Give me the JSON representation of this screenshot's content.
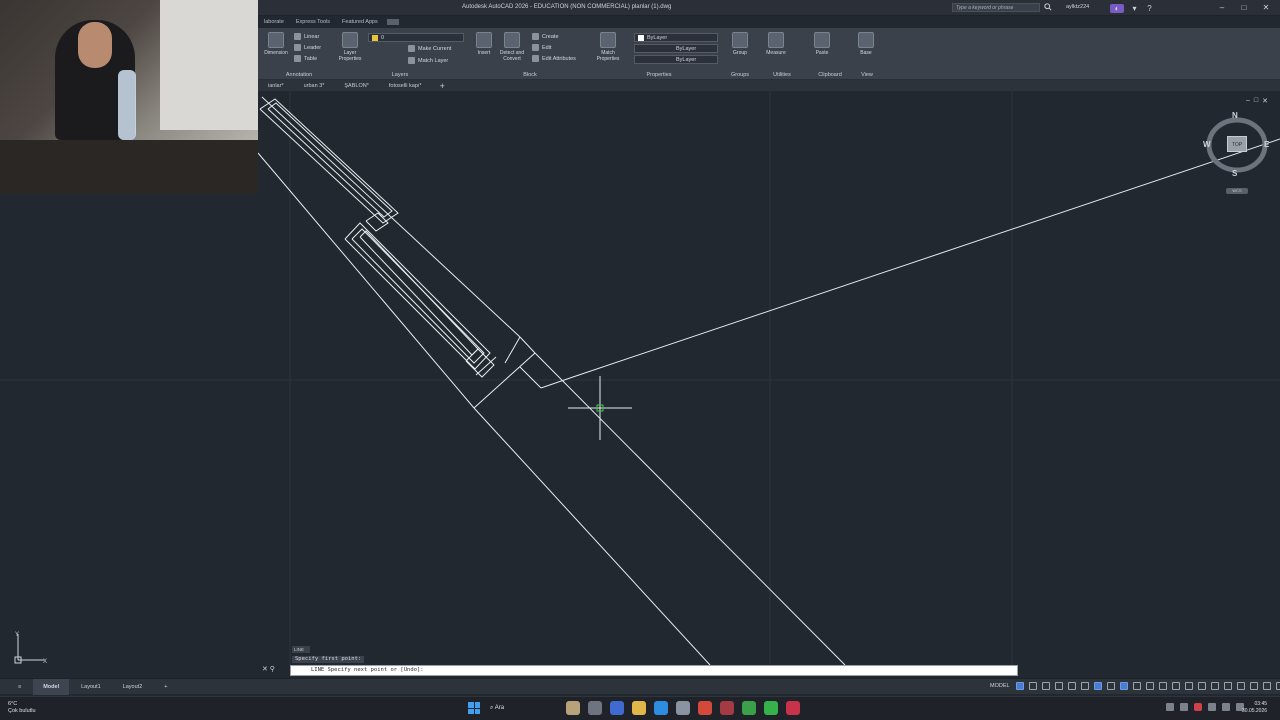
{
  "titlebar": {
    "app_title": "Autodesk AutoCAD 2026 - EDUCATION (NON COMMERCIAL)   planlar (1).dwg",
    "search_placeholder": "Type a keyword or phrase",
    "user_name": "aylktz224"
  },
  "ribbon_tabs": [
    "laborate",
    "Express Tools",
    "Featured Apps"
  ],
  "ribbon": {
    "annotation": {
      "dimension": "Dimension",
      "linear": "Linear",
      "leader": "Leader",
      "table": "Table",
      "label": "Annotation"
    },
    "layers": {
      "layer_properties": "Layer Properties",
      "layer_combo": "0",
      "make_current": "Make Current",
      "match_layer": "Match Layer",
      "label": "Layers"
    },
    "block": {
      "insert": "Insert",
      "detect_convert": "Detect and Convert",
      "create": "Create",
      "edit": "Edit",
      "edit_attributes": "Edit Attributes",
      "label": "Block"
    },
    "properties": {
      "match_properties": "Match Properties",
      "color": "ByLayer",
      "linetype": "ByLayer",
      "lineweight": "ByLayer",
      "label": "Properties"
    },
    "groups": {
      "group": "Group",
      "label": "Groups"
    },
    "utilities": {
      "measure": "Measure",
      "label": "Utilities"
    },
    "clipboard": {
      "paste": "Paste",
      "label": "Clipboard"
    },
    "view": {
      "base": "Base",
      "label": "View"
    }
  },
  "file_tabs": [
    "ianlar*",
    "urban 3*",
    "ŞABLON*",
    "fotoselli kapı*"
  ],
  "viewcube": {
    "north": "N",
    "south": "S",
    "east": "E",
    "west": "W",
    "face": "TOP",
    "wcs": "WCS"
  },
  "ucs": {
    "x": "X",
    "y": "Y"
  },
  "command": {
    "history_cmd": "LINE",
    "history_prompt": "Specify first point:",
    "current_prompt": "LINE Specify next point or [Undo]:"
  },
  "layouts": {
    "model": "Model",
    "layout1": "Layout1",
    "layout2": "Layout2",
    "add": "+"
  },
  "status": {
    "model_space": "MODEL"
  },
  "taskbar": {
    "weather_temp": "6°C",
    "weather_cond": "Çok bulutlu",
    "search": "Ara",
    "time": "03:45",
    "date": "30.05.2026"
  },
  "colors": {
    "canvas": "#212830",
    "ribbon": "#3b414b",
    "accent": "#4a7ccf",
    "geometry": "#ffffff",
    "cursor_center": "#3fd24a"
  }
}
